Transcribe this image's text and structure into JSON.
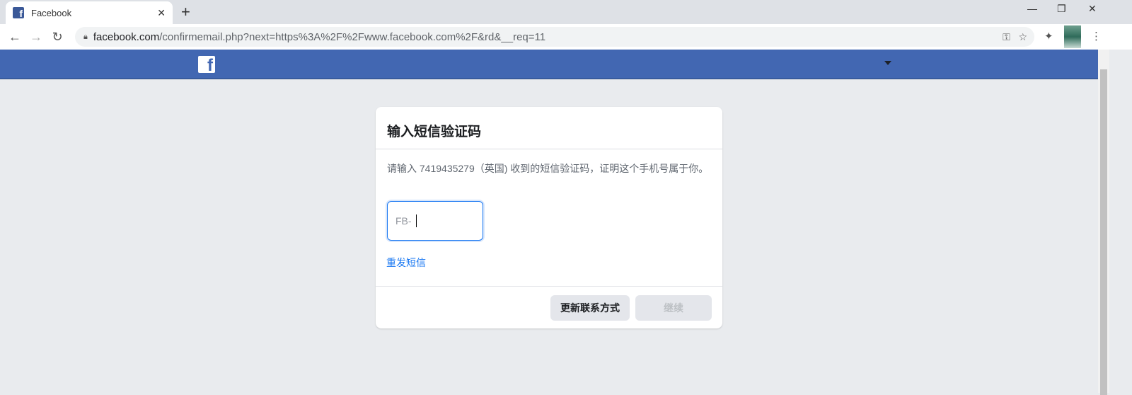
{
  "browser": {
    "tab_title": "Facebook",
    "url_host": "facebook.com",
    "url_path": "/confirmemail.php?next=https%3A%2F%2Fwww.facebook.com%2F&rd&__req=11"
  },
  "dialog": {
    "title": "输入短信验证码",
    "description": "请输入  7419435279（英国) 收到的短信验证码，证明这个手机号属于你。",
    "code_prefix": "FB-",
    "resend_link": "重发短信",
    "update_contact_button": "更新联系方式",
    "continue_button": "继续"
  },
  "colors": {
    "brand": "#4267b2",
    "link": "#1877f2"
  }
}
